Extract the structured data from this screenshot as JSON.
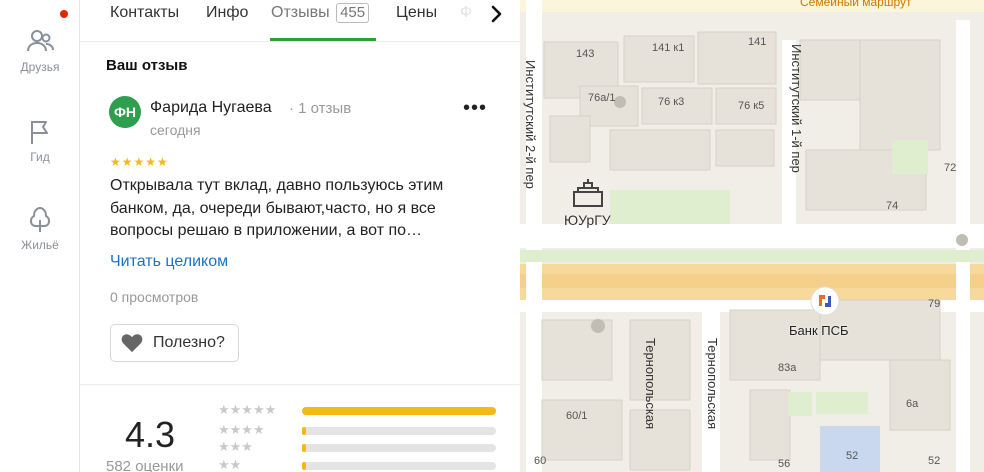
{
  "rail": {
    "items": [
      {
        "label": "Друзья",
        "icon": "friends-icon"
      },
      {
        "label": "Гид",
        "icon": "flag-icon"
      },
      {
        "label": "Жильё",
        "icon": "housing-icon"
      }
    ],
    "notification_color": "#e32400"
  },
  "tabs": {
    "items": [
      {
        "label": "Контакты"
      },
      {
        "label": "Инфо"
      },
      {
        "label": "Отзывы",
        "count": "455",
        "active": true
      },
      {
        "label": "Цены"
      },
      {
        "label": "Ф"
      }
    ],
    "accent": "#2e9e3a"
  },
  "my_review": {
    "section_title": "Ваш отзыв",
    "avatar_initials": "ФН",
    "author": "Фарида Нугаева",
    "author_meta": "· 1 отзыв",
    "date": "сегодня",
    "stars": "★★★★★",
    "text": "Открывала тут вклад, давно пользуюсь этим банком, да, очереди бывают,часто, но я все вопросы решаю в приложении, а вот по…",
    "read_more": "Читать целиком",
    "views": "0 просмотров",
    "useful_label": "Полезно?"
  },
  "rating_summary": {
    "value": "4.3",
    "count_label": "582 оценки",
    "distribution": [
      {
        "stars": "★★★★★",
        "fraction": 1.0
      },
      {
        "stars": "★★★★",
        "fraction": 0.02
      },
      {
        "stars": "★★★",
        "fraction": 0.02
      },
      {
        "stars": "★★",
        "fraction": 0.02
      }
    ],
    "bar_color": "#f5b819"
  },
  "map": {
    "top_label": "Семейный маршрут",
    "buildings": [
      "143",
      "141 к1",
      "141",
      "76а/1",
      "76 к3",
      "76 к5",
      "72",
      "74",
      "79",
      "83а",
      "60/1",
      "60",
      "56",
      "6а",
      "52",
      "52"
    ],
    "landmarks": [
      "ЮУрГУ",
      "Банк ПСБ"
    ],
    "streets": [
      "Институтский 2-й пер",
      "Институтский 1-й пер",
      "Тернопольская",
      "Тернопольская"
    ]
  }
}
